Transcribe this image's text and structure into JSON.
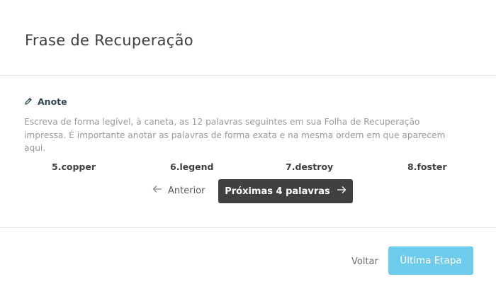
{
  "dialog": {
    "title": "Frase de Recuperação"
  },
  "note": {
    "heading": "Anote",
    "icon": "pencil-icon",
    "instructions": "Escreva de forma legível, à caneta, as 12 palavras seguintes em sua Folha de Recuperação impressa. É importante anotar as palavras de forma exata e na mesma ordem em que aparecem aqui."
  },
  "words": [
    {
      "label": "5.copper"
    },
    {
      "label": "6.legend"
    },
    {
      "label": "7.destroy"
    },
    {
      "label": "8.foster"
    }
  ],
  "pager": {
    "previous_label": "Anterior",
    "previous_icon": "arrow-left-icon",
    "next_label": "Próximas 4 palavras",
    "next_icon": "arrow-right-icon"
  },
  "footer": {
    "back_label": "Voltar",
    "final_label": "Última Etapa"
  },
  "colors": {
    "primary_dark": "#404040",
    "accent": "#6dcbee",
    "muted_text": "#9a9a9a",
    "divider": "#e3e3e3",
    "note_heading": "#2e4756"
  }
}
